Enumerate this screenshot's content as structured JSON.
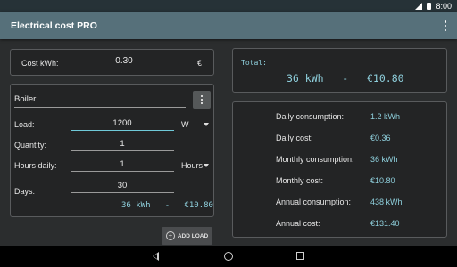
{
  "status_bar": {
    "time": "8:00"
  },
  "app_bar": {
    "title": "Electrical cost PRO"
  },
  "cost": {
    "label": "Cost kWh:",
    "value": "0.30",
    "currency": "€"
  },
  "load": {
    "name": "Boiler",
    "load_label": "Load:",
    "load_value": "1200",
    "load_unit": "W",
    "quantity_label": "Quantity:",
    "quantity_value": "1",
    "hours_label": "Hours daily:",
    "hours_value": "1",
    "hours_unit": "Hours",
    "days_label": "Days:",
    "days_value": "30",
    "result": "36 kWh   -   €10.80"
  },
  "add_load": {
    "label": "ADD LOAD"
  },
  "total": {
    "label": "Total:",
    "value": "36 kWh   -   €10.80"
  },
  "stats": [
    {
      "label": "Daily consumption:",
      "value": "1.2 kWh"
    },
    {
      "label": "Daily cost:",
      "value": "€0.36"
    },
    {
      "label": "Monthly consumption:",
      "value": "36 kWh"
    },
    {
      "label": "Monthly cost:",
      "value": "€10.80"
    },
    {
      "label": "Annual consumption:",
      "value": "438 kWh"
    },
    {
      "label": "Annual cost:",
      "value": "€131.40"
    }
  ],
  "colors": {
    "accent": "#8fd0dd",
    "app_bar": "#56707a",
    "background": "#2b2d2e"
  },
  "icons": [
    "signal-icon",
    "battery-icon",
    "overflow-menu-icon",
    "more-vert-icon",
    "dropdown-caret-icon",
    "add-circle-icon",
    "nav-back-icon",
    "nav-home-icon",
    "nav-recents-icon"
  ]
}
